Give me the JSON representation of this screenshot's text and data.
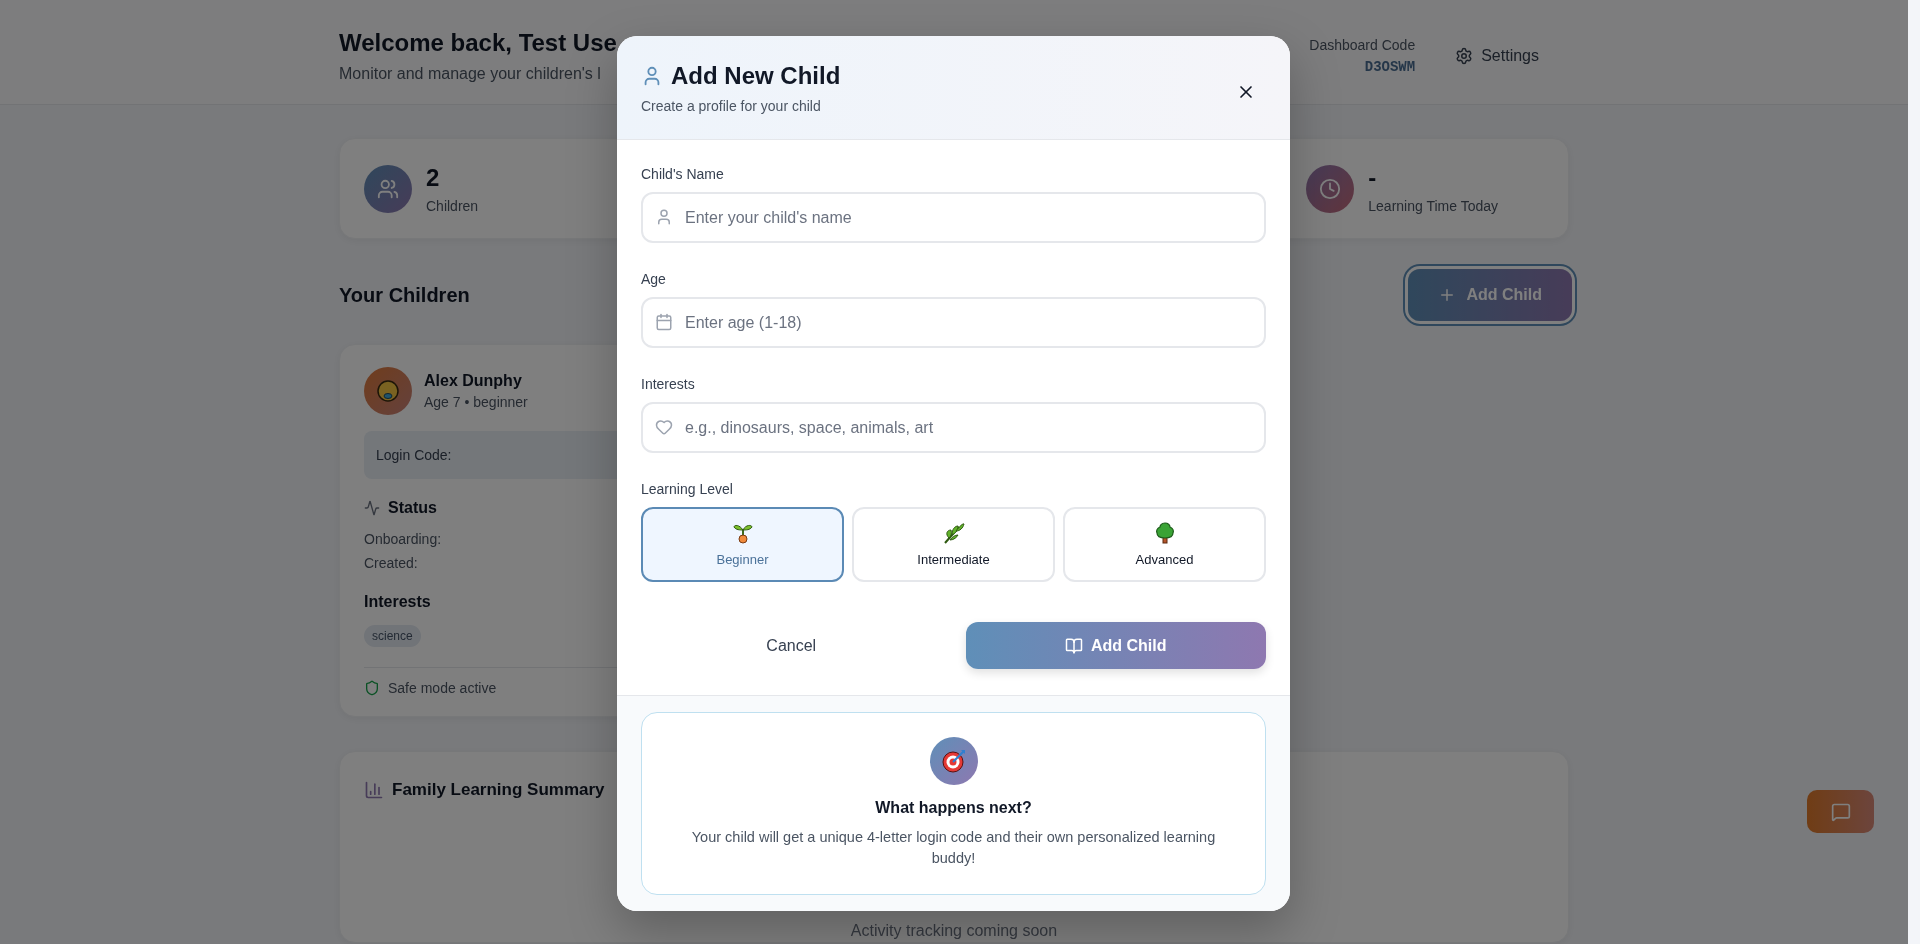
{
  "header": {
    "title": "Welcome back, Test Use",
    "subtitle": "Monitor and manage your children's l",
    "code_label": "Dashboard Code",
    "code": "D3OSWM",
    "settings": "Settings"
  },
  "stats": [
    {
      "kind": "people",
      "value": "2",
      "label": "Children"
    },
    {
      "kind": "clock",
      "value": "-",
      "label": "Learning Time Today"
    }
  ],
  "children_section": {
    "title": "Your Children",
    "add_button": "Add Child"
  },
  "child_card": {
    "name": "Alex Dunphy",
    "meta": "Age 7 • beginner",
    "login_label": "Login Code:",
    "status_title": "Status",
    "status_rows": [
      "Onboarding:",
      "Created:"
    ],
    "interests_title": "Interests",
    "interests": [
      "science"
    ],
    "safe_mode": "Safe mode active"
  },
  "summary": {
    "title": "Family Learning Summary",
    "message": "Activity tracking coming soon"
  },
  "modal": {
    "title": "Add New Child",
    "subtitle": "Create a profile for your child",
    "fields": [
      {
        "kind": "person",
        "label": "Child's Name",
        "placeholder": "Enter your child's name"
      },
      {
        "kind": "calendar",
        "label": "Age",
        "placeholder": "Enter age (1-18)"
      },
      {
        "kind": "heart",
        "label": "Interests",
        "placeholder": "e.g., dinosaurs, space, animals, art"
      }
    ],
    "level_label": "Learning Level",
    "levels": [
      {
        "kind": "sprout",
        "label": "Beginner",
        "selected": true
      },
      {
        "kind": "herb",
        "label": "Intermediate",
        "selected": false
      },
      {
        "kind": "tree",
        "label": "Advanced",
        "selected": false
      }
    ],
    "cancel": "Cancel",
    "submit": "Add Child",
    "info": {
      "title": "What happens next?",
      "text": "Your child will get a unique 4-letter login code and their own personalized learning buddy!"
    }
  }
}
